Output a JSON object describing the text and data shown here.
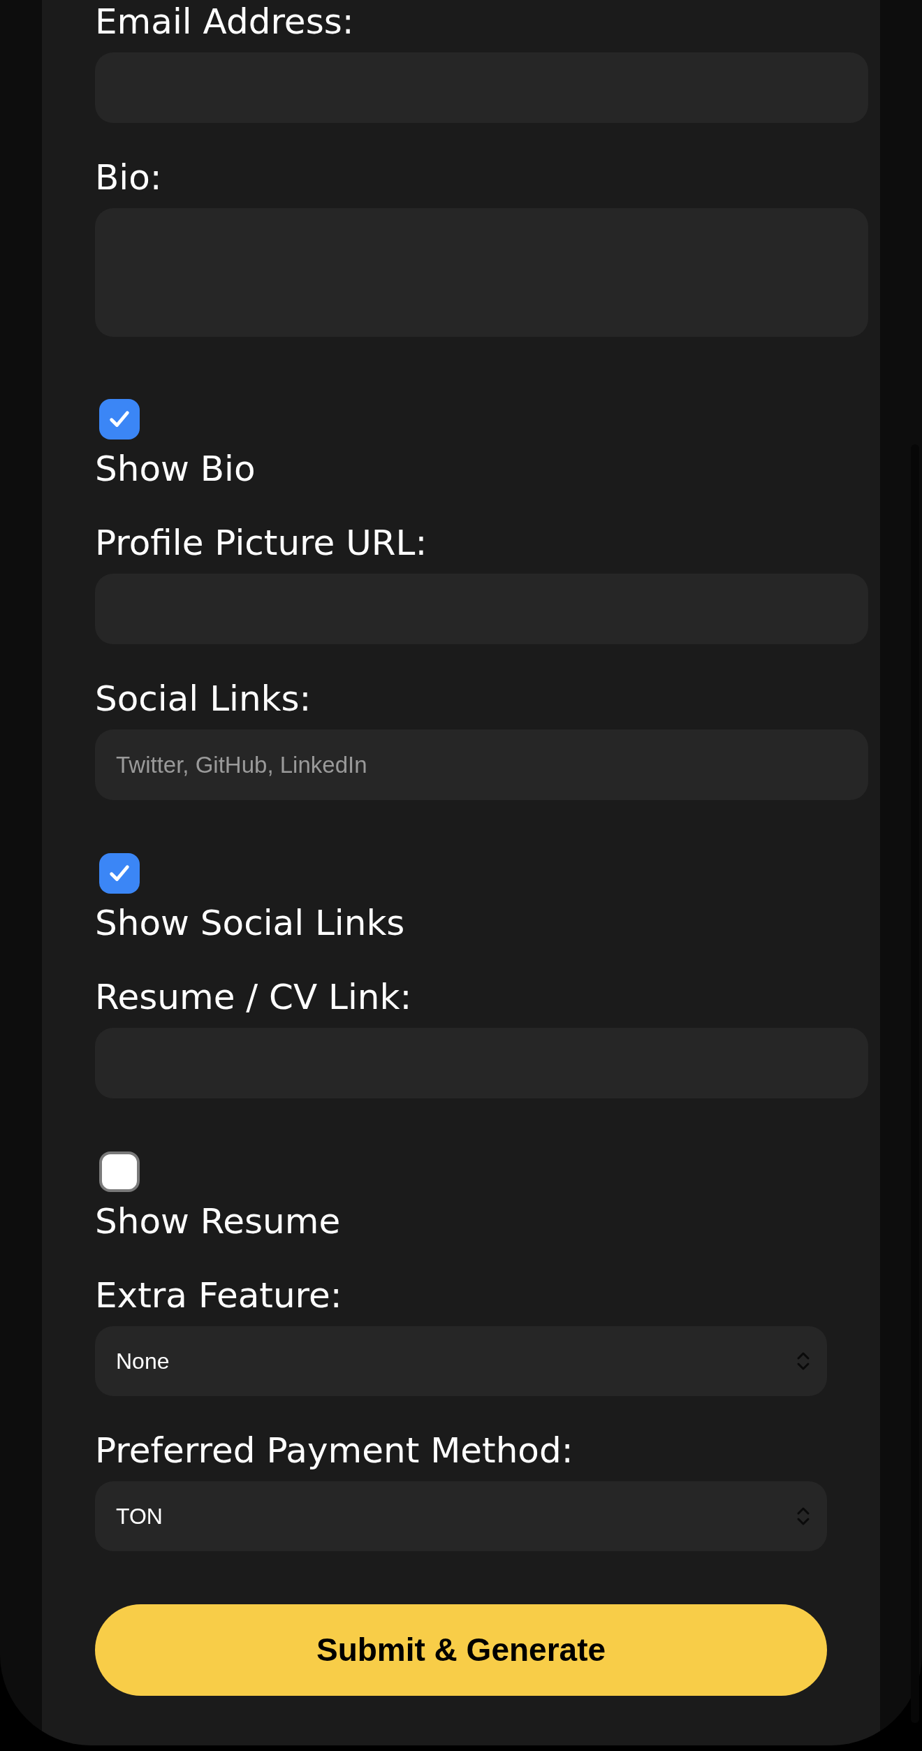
{
  "fields": [
    {
      "kind": "text",
      "label": "Email Address:"
    },
    {
      "kind": "textarea",
      "label": "Bio:"
    },
    {
      "kind": "checkbox",
      "label": "Show Bio",
      "checked": true
    },
    {
      "kind": "text",
      "label": "Profile Picture URL:"
    },
    {
      "kind": "text",
      "label": "Social Links:",
      "placeholder": "Twitter, GitHub, LinkedIn"
    },
    {
      "kind": "checkbox",
      "label": "Show Social Links",
      "checked": true
    },
    {
      "kind": "text",
      "label": "Resume / CV Link:"
    },
    {
      "kind": "checkbox",
      "label": "Show Resume",
      "checked": false
    },
    {
      "kind": "select",
      "label": "Extra Feature:",
      "value": "None"
    },
    {
      "kind": "select",
      "label": "Preferred Payment Method:",
      "value": "TON"
    }
  ],
  "submit_button": {
    "label": "Submit & Generate"
  }
}
